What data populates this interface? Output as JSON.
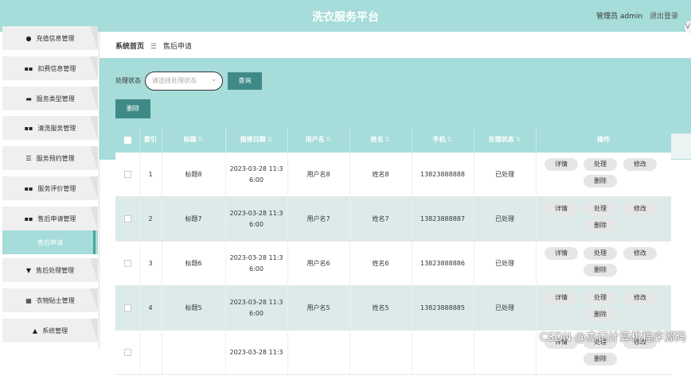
{
  "header": {
    "title": "洗衣服务平台",
    "user_role": "管理员",
    "username": "admin",
    "logout_label": "退出登录"
  },
  "sidebar": {
    "items": [
      {
        "label": "充值信息管理",
        "icon": "location-pin-icon"
      },
      {
        "label": "扣费信息管理",
        "icon": "grid-icon"
      },
      {
        "label": "服务类型管理",
        "icon": "monitor-icon"
      },
      {
        "label": "清洗服务管理",
        "icon": "grid-icon"
      },
      {
        "label": "服务预约管理",
        "icon": "sliders-icon"
      },
      {
        "label": "服务评价管理",
        "icon": "grid-icon"
      },
      {
        "label": "售后申请管理",
        "icon": "grid-icon"
      },
      {
        "label": "售后申请",
        "icon": "",
        "active": true
      },
      {
        "label": "售后处理管理",
        "icon": "pin-icon"
      },
      {
        "label": "衣物贴士管理",
        "icon": "grid9-icon"
      },
      {
        "label": "系统管理",
        "icon": "user-icon"
      }
    ]
  },
  "breadcrumb": {
    "home": "系统首页",
    "sep": "☰",
    "current": "售后申请"
  },
  "filter": {
    "label": "处理状态",
    "placeholder": "请选择处理状态",
    "query_label": "查询"
  },
  "toolbar": {
    "delete_label": "删除"
  },
  "table": {
    "headers": [
      "索引",
      "标题",
      "报修日期",
      "用户名",
      "姓名",
      "手机",
      "处理状态",
      "操作"
    ],
    "rows": [
      {
        "index": "1",
        "title": "标题8",
        "date1": "2023-03-28 11:3",
        "date2": "6:00",
        "username": "用户名8",
        "name": "姓名8",
        "phone": "13823888888",
        "status": "已处理"
      },
      {
        "index": "2",
        "title": "标题7",
        "date1": "2023-03-28 11:3",
        "date2": "6:00",
        "username": "用户名7",
        "name": "姓名7",
        "phone": "13823888887",
        "status": "已处理"
      },
      {
        "index": "3",
        "title": "标题6",
        "date1": "2023-03-28 11:3",
        "date2": "6:00",
        "username": "用户名6",
        "name": "姓名6",
        "phone": "13823888886",
        "status": "已处理"
      },
      {
        "index": "4",
        "title": "标题5",
        "date1": "2023-03-28 11:3",
        "date2": "6:00",
        "username": "用户名5",
        "name": "姓名5",
        "phone": "13823888885",
        "status": "已处理"
      },
      {
        "index": "",
        "title": "",
        "date1": "2023-03-28 11:3",
        "date2": "",
        "username": "",
        "name": "",
        "phone": "",
        "status": ""
      }
    ],
    "actions": {
      "detail": "详情",
      "process": "处理",
      "edit": "修改",
      "delete": "删除"
    }
  },
  "watermark": "CSDN @杰记计算机程序源码",
  "colors": {
    "accent": "#a6dcd9",
    "button": "#3f8a86",
    "row_alt": "#dcebea"
  }
}
